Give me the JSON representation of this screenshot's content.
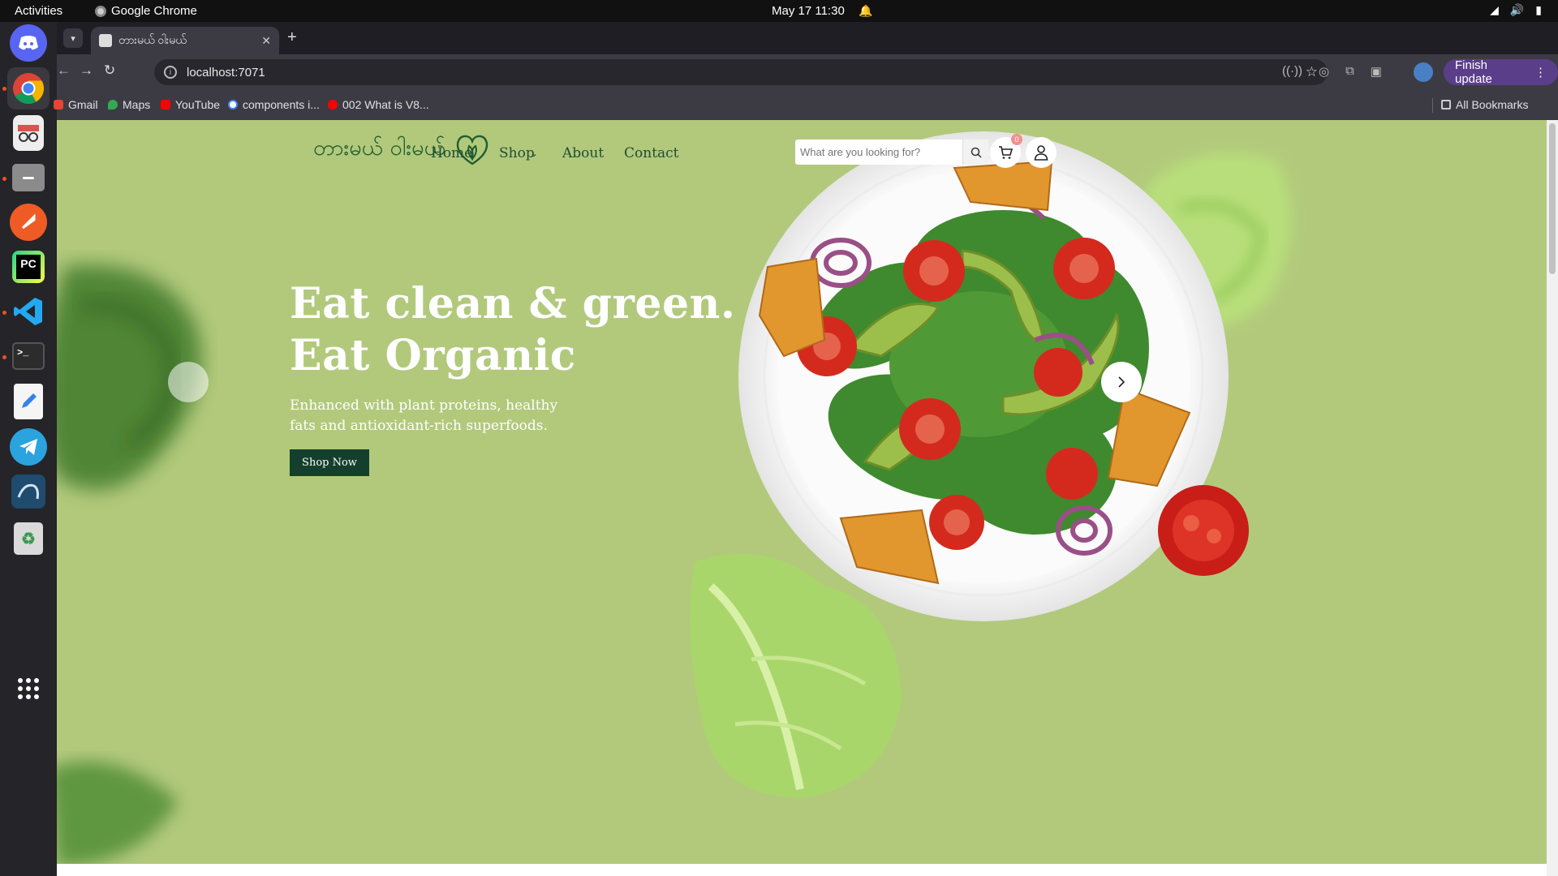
{
  "os": {
    "activities": "Activities",
    "app_name": "Google Chrome",
    "clock": "May 17  11:30"
  },
  "browser": {
    "tab_title": "တားမယ် ဝါးမယ်",
    "url": "localhost:7071",
    "finish_update": "Finish update",
    "bookmarks": [
      "Gmail",
      "Maps",
      "YouTube",
      "components i...",
      "002 What is V8..."
    ],
    "all_bookmarks": "All Bookmarks"
  },
  "site": {
    "logo_text": "တားမယ် ဝါးမယ်",
    "nav": {
      "home": "Home",
      "shop": "Shop",
      "about": "About",
      "contact": "Contact"
    },
    "search_placeholder": "What are you looking for?",
    "cart_count": "0",
    "hero": {
      "title_line1": "Eat clean & green.",
      "title_line2": "Eat Organic",
      "subtitle": "Enhanced with plant proteins, healthy fats and antioxidant-rich superfoods.",
      "cta": "Shop Now"
    }
  },
  "colors": {
    "page_bg": "#b2c97c",
    "brand_dark": "#153f2d",
    "nav_text": "#1f4d33"
  }
}
